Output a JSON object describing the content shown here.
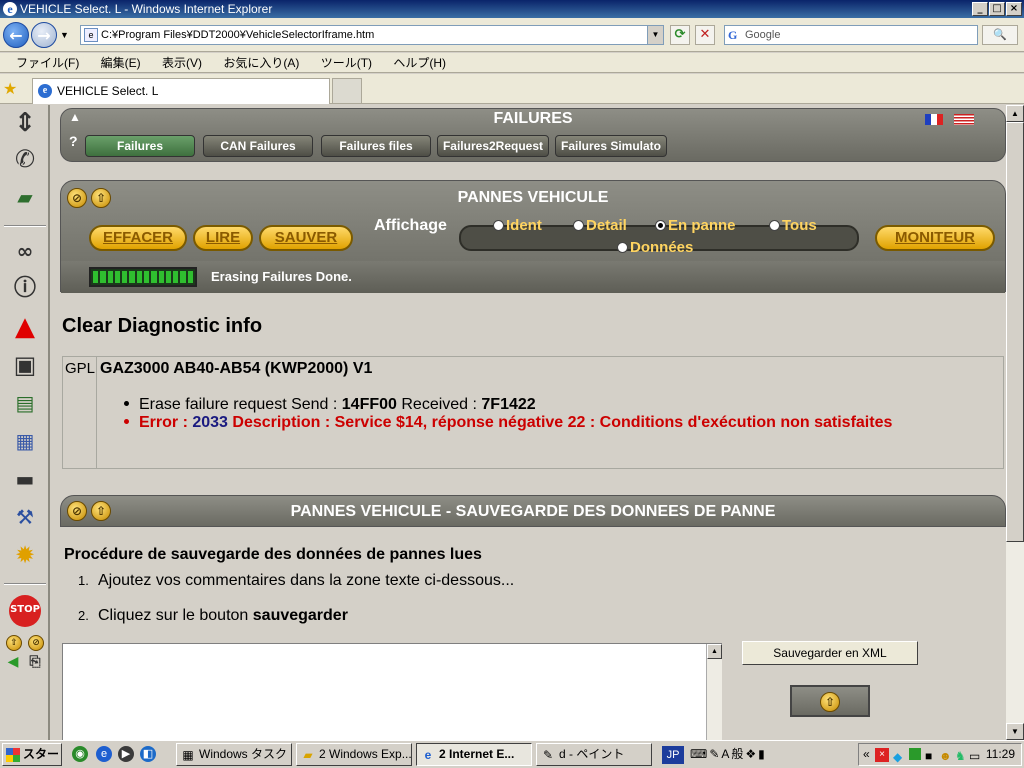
{
  "window": {
    "title": "VEHICLE Select. L - Windows Internet Explorer",
    "btn_min": "_",
    "btn_max": "□",
    "btn_close": "×"
  },
  "address": {
    "url": "C:¥Program Files¥DDT2000¥VehicleSelectorIframe.htm",
    "back": "←",
    "forward": "→",
    "refresh": "⟳",
    "stop": "✕",
    "search_placeholder": "Google",
    "search_go": "🔍"
  },
  "menu": [
    "ファイル(F)",
    "編集(E)",
    "表示(V)",
    "お気に入り(A)",
    "ツール(T)",
    "ヘルプ(H)"
  ],
  "tabs": {
    "active": "VEHICLE Select. L"
  },
  "failures_panel": {
    "title": "FAILURES",
    "help": "?",
    "tabs": [
      "Failures",
      "CAN Failures",
      "Failures files",
      "Failures2Request",
      "Failures Simulato"
    ]
  },
  "pannes": {
    "title": "PANNES VEHICULE",
    "buttons": {
      "effacer": "EFFACER",
      "lire": "LIRE",
      "sauver": "SAUVER",
      "moniteur": "MONITEUR"
    },
    "affichage_label": "Affichage",
    "radios": [
      {
        "label": "Ident",
        "selected": false
      },
      {
        "label": "Detail",
        "selected": false
      },
      {
        "label": "En panne",
        "selected": true
      },
      {
        "label": "Tous",
        "selected": false
      },
      {
        "label": "Données",
        "selected": false
      }
    ],
    "status": "Erasing Failures Done."
  },
  "clear": {
    "heading": "Clear Diagnostic info",
    "protocol": "GPL",
    "ecu": "GAZ3000 AB40-AB54 (KWP2000) V1",
    "line1_prefix": "Erase failure request  Send : ",
    "send": "14FF00",
    "received_label": "  Received : ",
    "received": "7F1422",
    "error_label": "Error : ",
    "error_code": "2033",
    "error_desc": "  Description : Service $14, réponse négative 22 : Conditions d'exécution non satisfaites"
  },
  "sauvegarde": {
    "title": "PANNES VEHICULE - SAUVEGARDE DES DONNEES DE PANNE",
    "heading": "Procédure de sauvegarde des données de pannes lues",
    "step1": "Ajoutez vos commentaires dans la zone texte ci-dessous...",
    "step2_prefix": "Cliquez sur le bouton ",
    "step2_bold": "sauvegarder",
    "xml_button": "Sauvegarder en XML"
  },
  "taskbar": {
    "start": "スタート",
    "tasks": [
      "Windows タスク ...",
      "2 Windows Exp...",
      "2 Internet E...",
      "d - ペイント"
    ],
    "lang": "JP",
    "clock": "11:29"
  }
}
